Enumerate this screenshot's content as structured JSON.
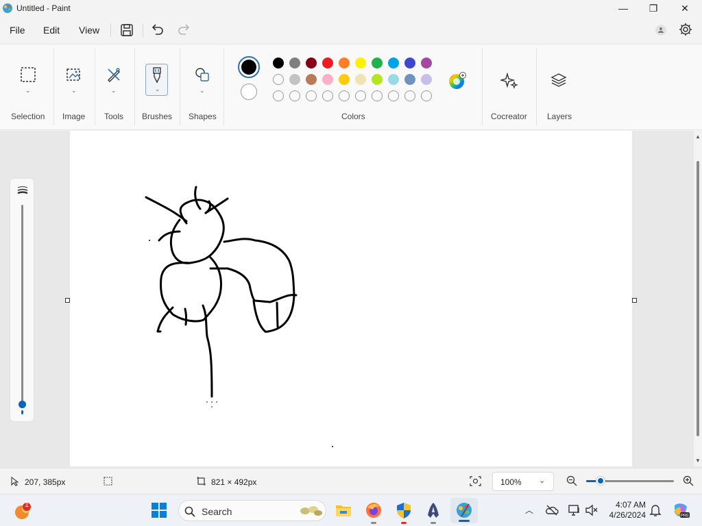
{
  "window": {
    "title": "Untitled - Paint",
    "controls": {
      "minimize": "—",
      "restore": "❐",
      "close": "✕"
    }
  },
  "menu": {
    "items": [
      "File",
      "Edit",
      "View"
    ]
  },
  "ribbon": {
    "groups": {
      "selection": "Selection",
      "image": "Image",
      "tools": "Tools",
      "brushes": "Brushes",
      "shapes": "Shapes",
      "colors": "Colors",
      "cocreator": "Cocreator",
      "layers": "Layers"
    },
    "primary_color": "#000000",
    "secondary_color": "#ffffff",
    "palette_row1": [
      "#000000",
      "#7f7f7f",
      "#880015",
      "#ed1c24",
      "#ff7f27",
      "#fff200",
      "#22b14c",
      "#00a2e8",
      "#3f48cc",
      "#a349a4"
    ],
    "palette_row2": [
      "#ffffff",
      "#c3c3c3",
      "#b97a57",
      "#ffaec9",
      "#ffc90e",
      "#efe4b0",
      "#b5e61d",
      "#99d9ea",
      "#7092be",
      "#c8bfe7"
    ],
    "palette_row3_count": 10
  },
  "status": {
    "cursor_position": "207, 385px",
    "canvas_size": "821 × 492px",
    "zoom": "100%"
  },
  "taskbar": {
    "search_placeholder": "Search",
    "time": "4:07 AM",
    "date": "4/26/2024",
    "badge": "1"
  },
  "colors": {
    "accent": "#0067c0",
    "chrome": "#f3f3f3"
  }
}
